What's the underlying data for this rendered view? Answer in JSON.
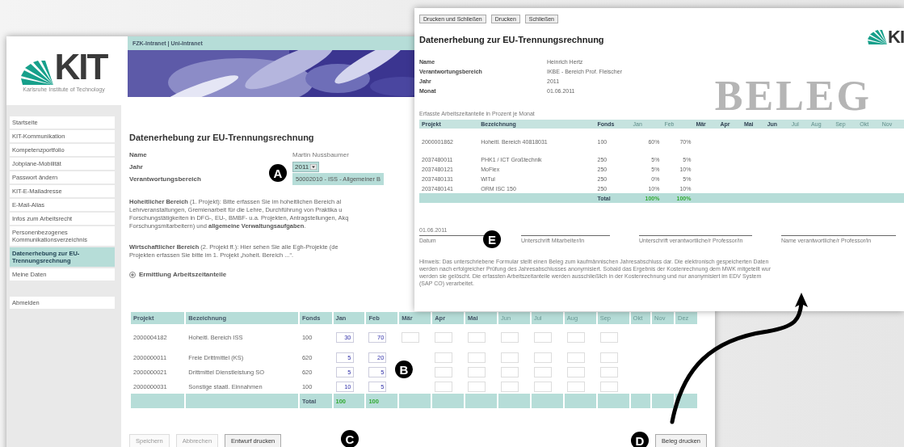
{
  "portal": {
    "header": "FZK-Intranet | Uni-Intranet",
    "logo": {
      "letters": "KIT",
      "subtitle": "Karlsruhe Institute of Technology"
    },
    "sidebar": {
      "items": [
        {
          "label": "Startseite",
          "selected": false
        },
        {
          "label": "KIT-Kommunikation",
          "selected": false
        },
        {
          "label": "Kompetenzportfolio",
          "selected": false
        },
        {
          "label": "Jobplane-Mobilität",
          "selected": false
        },
        {
          "label": "Passwort ändern",
          "selected": false
        },
        {
          "label": "KIT-E-Mailadresse",
          "selected": false
        },
        {
          "label": "E-Mail-Alias",
          "selected": false
        },
        {
          "label": "Infos zum Arbeitsrecht",
          "selected": false
        },
        {
          "label": "Personenbezogenes Kommunikationsverzeichnis",
          "selected": false
        },
        {
          "label": "Datenerhebung zur EU-Trennungsrechnung",
          "selected": true
        },
        {
          "label": "Meine Daten",
          "selected": false
        }
      ],
      "logout": "Abmelden"
    },
    "title": "Datenerhebung zur EU-Trennungsrechnung",
    "fields": [
      {
        "label": "Name",
        "value": "Martin Nussbaumer",
        "kind": "text"
      },
      {
        "label": "Jahr",
        "value": "2011",
        "kind": "dropdown"
      },
      {
        "label": "Verantwortungsbereich",
        "value": "50002010 - ISS - Allgemeiner B",
        "kind": "select"
      }
    ],
    "paragraphs": [
      {
        "lines": [
          "**Hoheitlicher Bereich** (1. Projekt): Bitte erfassen Sie im hoheitlichen Bereich al",
          "Lehrveranstaltungen, Gremienarbeit für die Lehre, Durchführung von Praktika u",
          "Forschungstätigkeiten in DFG-, EU-, BMBF- u.a. Projekten, Antragstellungen, Akq",
          "Forschungsmitarbeitern) und **allgemeine Verwaltungsaufgaben**."
        ]
      },
      {
        "lines": [
          "**Wirtschaftlicher Bereich** (2. Projekt ff.): Hier sehen Sie alle Egh-Projekte (de",
          "Projekten erfassen Sie bitte im 1. Projekt „hoheit. Bereich ...“."
        ]
      }
    ],
    "section": "Ermittlung Arbeitszeitanteile",
    "table": {
      "columns": [
        {
          "label": "Projekt",
          "kind": "info",
          "dimmed": false
        },
        {
          "label": "Bezeichnung",
          "kind": "info",
          "dimmed": false
        },
        {
          "label": "Fonds",
          "kind": "info",
          "dimmed": false
        },
        {
          "label": "Jan",
          "kind": "month",
          "dimmed": false,
          "inputs": true
        },
        {
          "label": "Feb",
          "kind": "month",
          "dimmed": false,
          "inputs": true
        },
        {
          "label": "Mär",
          "kind": "month",
          "dimmed": false,
          "inputs": true
        },
        {
          "label": "Apr",
          "kind": "month",
          "dimmed": false,
          "inputs": true
        },
        {
          "label": "Mai",
          "kind": "month",
          "dimmed": false,
          "inputs": true
        },
        {
          "label": "Jun",
          "kind": "month",
          "dimmed": true,
          "inputs": true
        },
        {
          "label": "Jul",
          "kind": "month",
          "dimmed": true,
          "inputs": true
        },
        {
          "label": "Aug",
          "kind": "month",
          "dimmed": true,
          "inputs": true
        },
        {
          "label": "Sep",
          "kind": "month",
          "dimmed": true,
          "inputs": true
        },
        {
          "label": "Okt",
          "kind": "month",
          "dimmed": true,
          "inputs": false
        },
        {
          "label": "Nov",
          "kind": "month",
          "dimmed": true,
          "inputs": false
        },
        {
          "label": "Dez",
          "kind": "month",
          "dimmed": true,
          "inputs": false
        }
      ],
      "rows": [
        {
          "cells": [
            "2000004182",
            "Hoheitl. Bereich ISS",
            "100"
          ],
          "months": [
            "30",
            "70"
          ],
          "leading_gap": false
        },
        {
          "cells": [
            "2000000011",
            "Freie Drittmittel (KS)",
            "620"
          ],
          "months": [
            "5",
            "20"
          ],
          "leading_gap": true
        },
        {
          "cells": [
            "2000000021",
            "Drittmittel Dienstleistung SO",
            "620"
          ],
          "months": [
            "5",
            "5"
          ],
          "leading_gap": true
        },
        {
          "cells": [
            "2000000031",
            "Sonstige staatl. Einnahmen",
            "100"
          ],
          "months": [
            "10",
            "5"
          ],
          "leading_gap": true
        }
      ],
      "total": {
        "label": "Total",
        "values": [
          "100",
          "100"
        ]
      }
    },
    "buttons": [
      {
        "label": "Speichern",
        "disabled": true
      },
      {
        "label": "Abbrechen",
        "disabled": true
      },
      {
        "label": "Entwurf drucken",
        "disabled": false
      }
    ],
    "print_button": "Beleg drucken"
  },
  "receipt": {
    "toolbar": [
      "Drucken und Schließen",
      "Drucken",
      "Schließen"
    ],
    "logo": "KI",
    "title": "Datenerhebung zur EU-Trennungsrechnung",
    "fields": [
      {
        "label": "Name",
        "value": "Heinrich Hertz"
      },
      {
        "label": "Verantwortungsbereich",
        "value": "IKBE - Bereich Prof. Fleischer"
      },
      {
        "label": "Jahr",
        "value": "2011"
      },
      {
        "label": "Monat",
        "value": "01.06.2011"
      }
    ],
    "stamp": "BELEG",
    "caption": "Erfasste Arbeitszeitanteile in Prozent je Monat",
    "columns": [
      {
        "label": "Projekt",
        "dimmed": false
      },
      {
        "label": "Bezeichnung",
        "dimmed": false
      },
      {
        "label": "Fonds",
        "dimmed": false
      },
      {
        "label": "Jan",
        "dimmed": true
      },
      {
        "label": "Feb",
        "dimmed": true
      },
      {
        "label": "Mär",
        "dimmed": false
      },
      {
        "label": "Apr",
        "dimmed": false
      },
      {
        "label": "Mai",
        "dimmed": false
      },
      {
        "label": "Jun",
        "dimmed": false
      },
      {
        "label": "Jul",
        "dimmed": true
      },
      {
        "label": "Aug",
        "dimmed": true
      },
      {
        "label": "Sep",
        "dimmed": true
      },
      {
        "label": "Okt",
        "dimmed": true
      },
      {
        "label": "Nov",
        "dimmed": true
      }
    ],
    "rows": [
      {
        "cells": [
          "2000001862",
          "Hoheitl. Bereich 40818031",
          "100"
        ],
        "months": [
          "60%",
          "70%"
        ]
      },
      {
        "cells": [
          "2037480011",
          "PHK1 / ICT Großtechnik",
          "250"
        ],
        "months": [
          "5%",
          "5%"
        ]
      },
      {
        "cells": [
          "2037480121",
          "MoFlex",
          "250"
        ],
        "months": [
          "5%",
          "10%"
        ]
      },
      {
        "cells": [
          "2037480131",
          "WiTul",
          "250"
        ],
        "months": [
          "0%",
          "5%"
        ]
      },
      {
        "cells": [
          "2037480141",
          "ORM ISC 150",
          "250"
        ],
        "months": [
          "10%",
          "10%"
        ]
      }
    ],
    "total": {
      "label": "Total",
      "values": [
        "100%",
        "100%"
      ]
    },
    "date": "01.06.2011",
    "signatures": [
      "Datum",
      "Unterschrift Mitarbeiter/in",
      "Unterschrift verantwortliche/r Professor/in",
      "Name verantwortliche/r Professor/in"
    ],
    "note": [
      "Hinweis: Das unterschriebene Formular stellt einen Beleg zum kaufmännischen Jahresabschluss dar. Die elektronisch gespeicherten Daten",
      "werden nach erfolgreicher Prüfung des Jahresabschlusses anonymisiert. Sobald das Ergebnis der Kostenrechnung dem MWK mitgeteilt wur",
      "werden sie gelöscht. Die erfassten Arbeitszeitanteile werden ausschließlich in der Kostenrechnung und nur anonymisiert im EDV System",
      "(SAP CO) verarbeitet."
    ]
  },
  "markers": [
    "A",
    "B",
    "C",
    "D",
    "E"
  ]
}
